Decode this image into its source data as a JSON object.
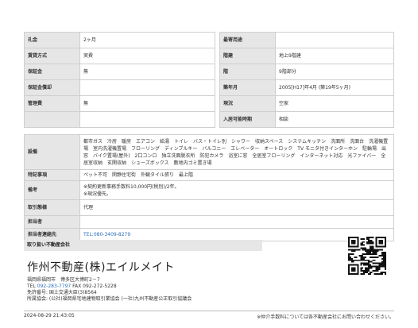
{
  "table1": {
    "rows": [
      {
        "l_label": "礼金",
        "l_value": "2ヶ月",
        "r_label": "最寄用途",
        "r_value": ""
      },
      {
        "l_label": "賃貸方式",
        "l_value": "実費",
        "r_label": "階建",
        "r_value": "地上9階建"
      },
      {
        "l_label": "保証金",
        "l_value": "無",
        "r_label": "階",
        "r_value": "9階部分"
      },
      {
        "l_label": "保証金償却",
        "l_value": "",
        "r_label": "築年月",
        "r_value": "2005[H17]年4月 (築19年5ヶ月)"
      },
      {
        "l_label": "管理費",
        "l_value": "無",
        "r_label": "現況",
        "r_value": "空家"
      },
      {
        "l_label": "",
        "l_value": "",
        "r_label": "入居可能時期",
        "r_value": "相談"
      }
    ]
  },
  "table2": {
    "facilities_label": "設備",
    "facilities_value": "都市ガス　冷房　暖房　エアコン　給湯　トイレ　バス・トイレ別　シャワー　収納スペース　システムキッチン　洗面所　洗面台　洗濯機置場　室内洗濯機置場　フローリング　ディンプルキー　バルコニー　エレベーター　オートロック　TV モニタ付きインターホン　駐輪場　出窓　バイク置場(屋外)　2口コンロ　独立洗面脱衣所　防犯カメラ　浴室に窓　全居室フローリング　インターネット対応　光ファイバー　全居室収納　玄関収納　シューズボックス　敷地内ゴミ置き場",
    "special_label": "特記事項",
    "special_value": "ペット不可　閑静住宅街　外観タイル張り　最上階",
    "remarks_label": "備考",
    "remarks_line1": "※契約更新事務手数料10,000円(税別)/2年。",
    "remarks_line2": "※現況優先。",
    "trade_label": "取引態様",
    "trade_value": "代理",
    "person_label": "担当者",
    "person_value": "",
    "contact_label": "担当者連絡先",
    "contact_value": "TEL:080-3409-8279"
  },
  "company": {
    "header": "取り扱い不動産会社",
    "name": "作州不動産(株)エイルメイト",
    "address": "福岡県福岡市　博多区大博町2－7",
    "tel_prefix": "TEL ",
    "tel": "092-283-7797",
    "fax": " FAX 092-272-5228",
    "license": "免許番号: 国土交通大臣(3)8564",
    "association": "所属協会: (公社)福岡県宅地建物取引業協会 (一社)九州不動産公正取引協議会"
  },
  "footer": {
    "timestamp": "2024-08-29 21:43:05",
    "note": "※仲介手数料については各不動産会社にお問い合わせください。"
  },
  "colors": {
    "label_bg": "#e6e6e6",
    "border": "#cfcfcf",
    "link": "#2a6fb8"
  }
}
